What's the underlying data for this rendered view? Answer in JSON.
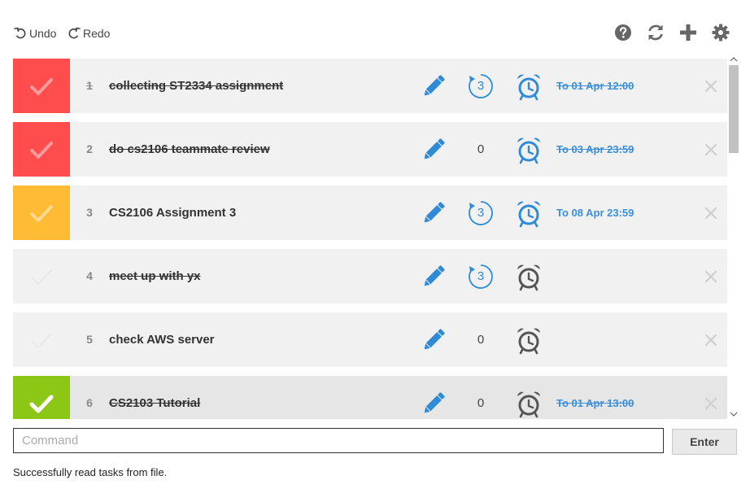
{
  "toolbar": {
    "undo_label": "Undo",
    "redo_label": "Redo",
    "icons": [
      "help-icon",
      "refresh-icon",
      "add-icon",
      "gear-icon"
    ]
  },
  "tasks": [
    {
      "index": "1",
      "name": "collecting ST2334 assignment",
      "name_struck": true,
      "index_struck": true,
      "check_color": "#ff4c4c",
      "check_style": "faded",
      "repeat": "3",
      "repeat_style": "circle",
      "alarm_color": "#2f8ad8",
      "deadline": "To 01 Apr 12:00",
      "deadline_struck": true
    },
    {
      "index": "2",
      "name": "do cs2106 teammate review",
      "name_struck": true,
      "index_struck": false,
      "check_color": "#ff4c4c",
      "check_style": "faded",
      "repeat": "0",
      "repeat_style": "plain",
      "alarm_color": "#2f8ad8",
      "deadline": "To 03 Apr 23:59",
      "deadline_struck": true
    },
    {
      "index": "3",
      "name": "CS2106 Assignment 3",
      "name_struck": false,
      "index_struck": false,
      "check_color": "#ffbb33",
      "check_style": "faded",
      "repeat": "3",
      "repeat_style": "circle",
      "alarm_color": "#2f8ad8",
      "deadline": "To 08 Apr 23:59",
      "deadline_struck": false
    },
    {
      "index": "4",
      "name": "meet up with yx",
      "name_struck": true,
      "index_struck": false,
      "check_color": "#f1f1f1",
      "check_style": "ghost",
      "repeat": "3",
      "repeat_style": "circle",
      "alarm_color": "#555555",
      "deadline": "",
      "deadline_struck": false
    },
    {
      "index": "5",
      "name": "check AWS server",
      "name_struck": false,
      "index_struck": false,
      "check_color": "#f1f1f1",
      "check_style": "ghost",
      "repeat": "0",
      "repeat_style": "plain",
      "alarm_color": "#555555",
      "deadline": "",
      "deadline_struck": false
    },
    {
      "index": "6",
      "name": "CS2103 Tutorial",
      "name_struck": true,
      "index_struck": false,
      "check_color": "#8cc716",
      "check_style": "solid",
      "repeat": "0",
      "repeat_style": "plain",
      "alarm_color": "#555555",
      "deadline": "To 01 Apr 13:00",
      "deadline_struck": true
    }
  ],
  "command": {
    "placeholder": "Command",
    "value": ""
  },
  "enter_label": "Enter",
  "status": "Successfully read tasks from file.",
  "colors": {
    "accent_blue": "#2f8ad8",
    "row_bg": "#f1f1f1",
    "overdue_red": "#ff4c4c",
    "due_soon_orange": "#ffbb33",
    "done_green": "#8cc716"
  }
}
